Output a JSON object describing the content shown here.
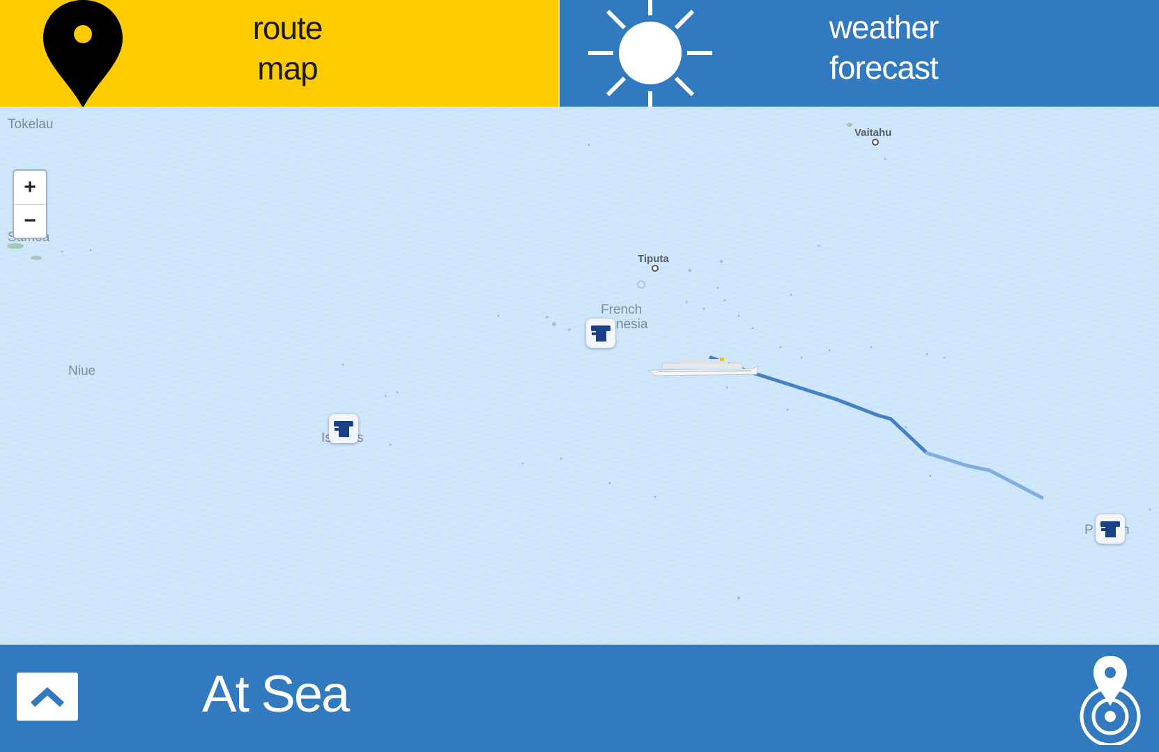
{
  "tabs": {
    "route": {
      "line1": "route",
      "line2": "map",
      "color": "#fdcb00"
    },
    "weather": {
      "line1": "weather",
      "line2": "forecast",
      "color": "#317ac0"
    }
  },
  "map": {
    "zoom_in": "+",
    "zoom_out": "−",
    "labels": {
      "tokelau": "Tokelau",
      "samoa": "Samoa",
      "niue": "Niue",
      "vaitahu": "Vaitahu",
      "tiputa": "Tiputa",
      "french": "French",
      "nesia": "nesia",
      "is": "Is",
      "s": "s",
      "p": "P",
      "n": "n"
    },
    "port_icon": "port-anchor-icon",
    "ship_icon": "cruise-ship-icon",
    "route_color": "#2c6fbd",
    "water_color": "#cde5fb"
  },
  "status": {
    "text": "At Sea",
    "expand_icon": "chevron-up-icon",
    "locate_icon": "locate-pin-icon"
  }
}
